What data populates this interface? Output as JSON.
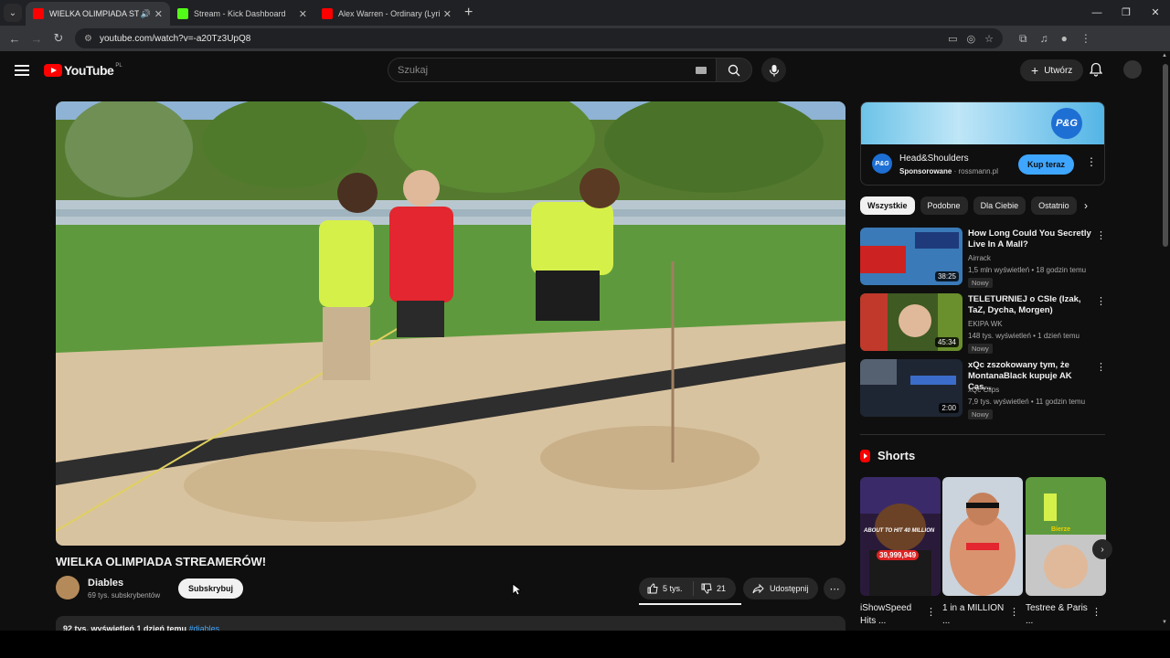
{
  "browser": {
    "tabs": [
      {
        "title": "WIELKA OLIMPIADA STREAMERÓW",
        "favicon_color": "#ff0000",
        "active": true
      },
      {
        "title": "Stream - Kick Dashboard",
        "favicon_color": "#53fc18",
        "active": false
      },
      {
        "title": "Alex Warren - Ordinary (Lyrics)",
        "favicon_color": "#ff0000",
        "active": false
      }
    ],
    "url": "youtube.com/watch?v=-a20Tz3UpQ8"
  },
  "header": {
    "logo_text": "YouTube",
    "country_code": "PL",
    "search_placeholder": "Szukaj",
    "create_label": "Utwórz"
  },
  "video": {
    "title": "WIELKA OLIMPIADA STREAMERÓW!",
    "channel_name": "Diables",
    "subscribers": "69 tys. subskrybentów",
    "subscribe_label": "Subskrybuj",
    "likes": "5 tys.",
    "dislikes": "21",
    "share_label": "Udostępnij",
    "description_stats": "92 tys. wyświetleń  1 dzień temu",
    "description_tag": "#diables"
  },
  "ad": {
    "banner_logo": "P&G",
    "title": "Head&Shoulders",
    "sponsored": "Sponsorowane",
    "domain": "rossmann.pl",
    "cta": "Kup teraz"
  },
  "chips": [
    "Wszystkie",
    "Podobne",
    "Dla Ciebie",
    "Ostatnio"
  ],
  "recommendations": [
    {
      "title": "How Long Could You Secretly Live In A Mall?",
      "channel": "Airrack",
      "meta": "1,5 mln wyświetleń • 18 godzin temu",
      "badge": "Nowy",
      "duration": "38:25"
    },
    {
      "title": "TELETURNIEJ o CSIe (Izak, TaZ, Dycha, Morgen)",
      "channel": "EKIPA WK",
      "meta": "148 tys. wyświetleń • 1 dzień temu",
      "badge": "Nowy",
      "duration": "45:34"
    },
    {
      "title": "xQc zszokowany tym, że MontanaBlack kupuje AK Cas...",
      "channel": "xQc Clips",
      "meta": "7,9 tys. wyświetleń • 11 godzin temu",
      "badge": "Nowy",
      "duration": "2:00"
    }
  ],
  "shorts": {
    "heading": "Shorts",
    "items": [
      {
        "label": "iShowSpeed Hits ...",
        "overlay": "ABOUT TO HIT 40 MILLION",
        "count": "39,999,949"
      },
      {
        "label": "1 in a MILLION ...",
        "overlay": "",
        "count": ""
      },
      {
        "label": "Testree & Paris ...",
        "overlay": "Bierze",
        "count": ""
      }
    ]
  },
  "colors": {
    "accent": "#ff0000",
    "link": "#3ea6ff",
    "background": "#0f0f0f"
  }
}
